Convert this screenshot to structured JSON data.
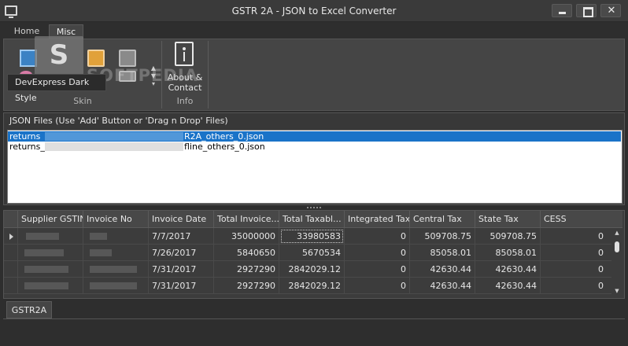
{
  "window": {
    "title": "GSTR 2A - JSON to Excel Converter",
    "close_glyph": "✕"
  },
  "ribbon": {
    "tabs": [
      {
        "label": "Home"
      },
      {
        "label": "Misc"
      }
    ],
    "skin_group": {
      "label": "Skin",
      "tooltip": "DevExpress Dark Style"
    },
    "info_group": {
      "label": "Info",
      "about_label": "About & Contact"
    }
  },
  "watermark": {
    "text": "SOFTPEDIA"
  },
  "files": {
    "title": "JSON Files (Use 'Add' Button or 'Drag n Drop' Files)",
    "items": [
      {
        "prefix": "returns",
        "suffix": "R2A_others_0.json",
        "selected": true
      },
      {
        "prefix": "returns_",
        "suffix": "fline_others_0.json",
        "selected": false
      }
    ]
  },
  "grid": {
    "columns": [
      "Supplier GSTIN",
      "Invoice No",
      "Invoice Date",
      "Total Invoice...",
      "Total Taxabl...",
      "Integrated Tax",
      "Central Tax",
      "State Tax",
      "CESS"
    ],
    "rows": [
      {
        "date": "7/7/2017",
        "total_invoice": "35000000",
        "total_taxable": "33980583",
        "integrated": "0",
        "central": "509708.75",
        "state": "509708.75",
        "cess": "0"
      },
      {
        "date": "7/26/2017",
        "total_invoice": "5840650",
        "total_taxable": "5670534",
        "integrated": "0",
        "central": "85058.01",
        "state": "85058.01",
        "cess": "0"
      },
      {
        "date": "7/31/2017",
        "total_invoice": "2927290",
        "total_taxable": "2842029.12",
        "integrated": "0",
        "central": "42630.44",
        "state": "42630.44",
        "cess": "0"
      },
      {
        "date": "7/31/2017",
        "total_invoice": "2927290",
        "total_taxable": "2842029.12",
        "integrated": "0",
        "central": "42630.44",
        "state": "42630.44",
        "cess": "0"
      }
    ]
  },
  "bottom_tabs": [
    {
      "label": "GSTR2A"
    }
  ],
  "icons": {
    "app": "monitor-icon",
    "about": "info-document-icon"
  }
}
